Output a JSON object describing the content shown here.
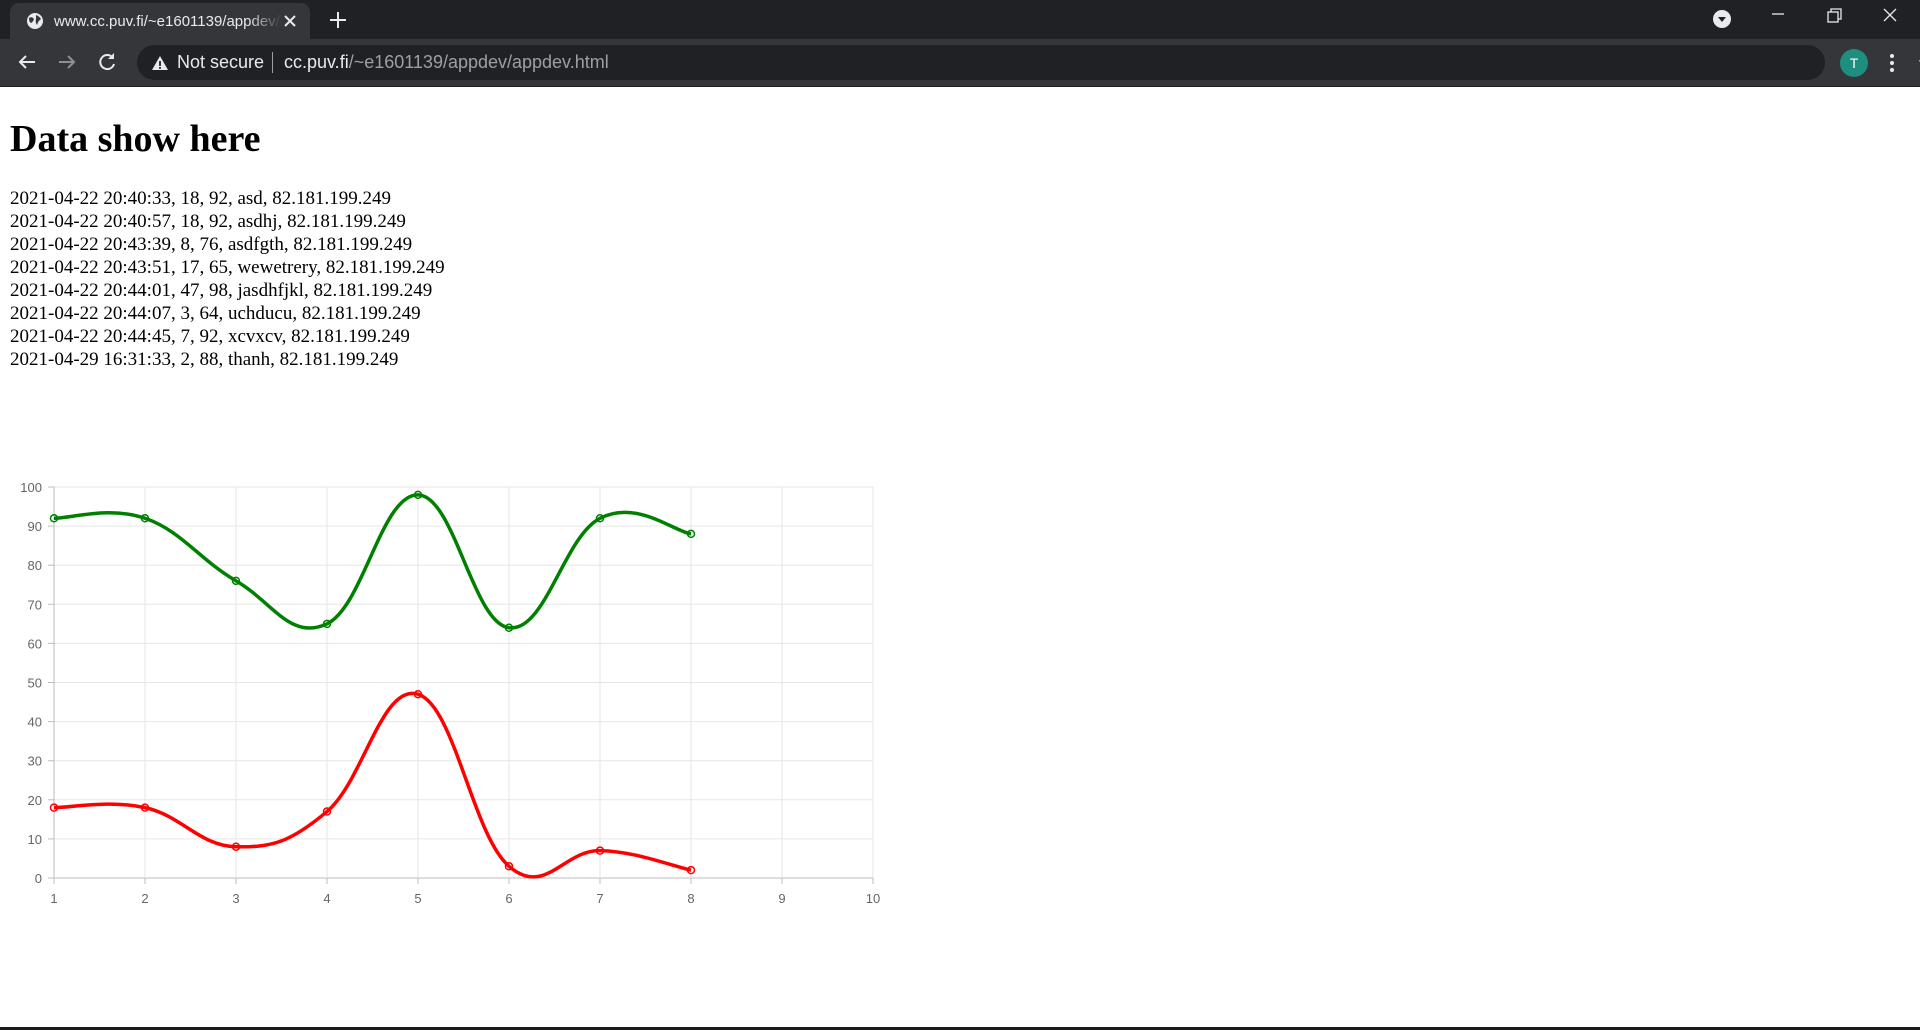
{
  "browser": {
    "tab": {
      "title": "www.cc.puv.fi/~e1601139/appdev/appdev.html"
    },
    "omnibox": {
      "security_label": "Not secure",
      "url_host": "cc.puv.fi",
      "url_path": "/~e1601139/appdev/appdev.html"
    },
    "profile_initial": "T"
  },
  "page": {
    "title": "Data show here",
    "records": [
      "2021-04-22 20:40:33, 18, 92, asd, 82.181.199.249",
      "2021-04-22 20:40:57, 18, 92, asdhj, 82.181.199.249",
      "2021-04-22 20:43:39, 8, 76, asdfgth, 82.181.199.249",
      "2021-04-22 20:43:51, 17, 65, wewetrery, 82.181.199.249",
      "2021-04-22 20:44:01, 47, 98, jasdhfjkl, 82.181.199.249",
      "2021-04-22 20:44:07, 3, 64, uchducu, 82.181.199.249",
      "2021-04-22 20:44:45, 7, 92, xcvxcv, 82.181.199.249",
      "2021-04-29 16:31:33, 2, 88, thanh, 82.181.199.249"
    ]
  },
  "chart_data": {
    "type": "line",
    "x": [
      1,
      2,
      3,
      4,
      5,
      6,
      7,
      8
    ],
    "x_ticks": [
      1,
      2,
      3,
      4,
      5,
      6,
      7,
      8,
      9,
      10
    ],
    "y_ticks": [
      0,
      10,
      20,
      30,
      40,
      50,
      60,
      70,
      80,
      90,
      100
    ],
    "xlim": [
      1,
      10
    ],
    "ylim": [
      0,
      100
    ],
    "grid": true,
    "smooth": true,
    "series": [
      {
        "color": "#008000",
        "values": [
          92,
          92,
          76,
          65,
          98,
          64,
          92,
          88
        ]
      },
      {
        "color": "#ff0000",
        "values": [
          18,
          18,
          8,
          17,
          47,
          3,
          7,
          2
        ]
      }
    ]
  }
}
